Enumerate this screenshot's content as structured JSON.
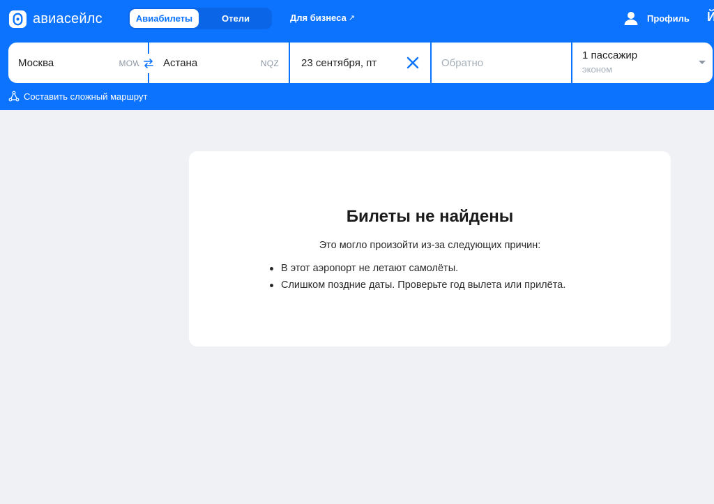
{
  "header": {
    "logo_text": "авиасейлс",
    "tabs": [
      {
        "label": "Авиабилеты",
        "active": true
      },
      {
        "label": "Отели",
        "active": false
      }
    ],
    "business_link": "Для бизнеса",
    "business_arrow": "↗",
    "profile_label": "Профиль",
    "edge_glyph": "Й"
  },
  "search": {
    "origin": {
      "city": "Москва",
      "code": "MOW"
    },
    "destination": {
      "city": "Астана",
      "code": "NQZ"
    },
    "depart_date": "23 сентября, пт",
    "return_placeholder": "Обратно",
    "passengers": "1 пассажир",
    "cabin_class": "эконом",
    "complex_route_label": "Составить сложный маршрут"
  },
  "result": {
    "title": "Билеты не найдены",
    "subtitle": "Это могло произойти из-за следующих причин:",
    "reasons": [
      "В этот аэропорт не летают самолёты.",
      "Слишком поздние даты. Проверьте год вылета или прилёта."
    ]
  },
  "icons": {
    "logo": "aviasales-logo-icon",
    "swap": "swap-arrows-icon",
    "clear": "close-icon",
    "caret": "chevron-down-icon",
    "profile": "user-icon",
    "route": "route-triangle-icon"
  },
  "colors": {
    "brand": "#0c73fe",
    "page_bg": "#eff1f4",
    "card_bg": "#ffffff",
    "muted_text": "#a5afb9"
  }
}
